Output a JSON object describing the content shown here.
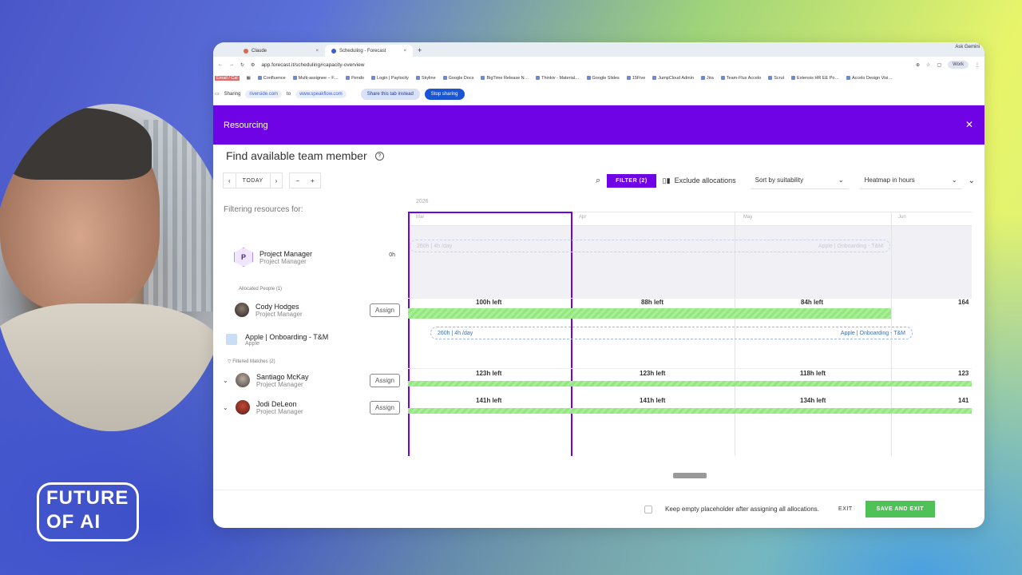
{
  "overlay": {
    "logo_line1": "FUTURE",
    "logo_line2": "OF AI"
  },
  "browser": {
    "tabs": [
      {
        "label": "Claude"
      },
      {
        "label": "Scheduling - Forecast"
      }
    ],
    "ask": "Ask Gemini",
    "url": "app.forecast.it/scheduling#capacity-overview",
    "profile": "Work",
    "bookmarks": [
      "Email / Cal",
      "Confluence",
      "Multi-assignee – F…",
      "Pendo",
      "Login | Paylocity",
      "Skyline",
      "Google Docs",
      "BigTime Release N…",
      "Thinkiv - Material…",
      "Google Slides",
      "15Five",
      "JumpCloud Admin",
      "Jira",
      "Team-Flux Accelo",
      "Scrut",
      "Extensis HR EE Po…",
      "Accelo Design Visi…"
    ],
    "share": {
      "label": "Sharing",
      "from": "riverside.com",
      "to_label": "to",
      "to": "www.speakflow.com",
      "share_this": "Share this tab instead",
      "stop": "Stop sharing"
    }
  },
  "modal": {
    "title": "Resourcing",
    "find_title": "Find available team member",
    "toolbar": {
      "today": "TODAY",
      "filter": "FILTER (2)",
      "exclude": "Exclude allocations",
      "sort": "Sort by suitability",
      "heatmap": "Heatmap in hours"
    },
    "filtering_for": "Filtering resources for:",
    "placeholder": {
      "initial": "P",
      "name": "Project Manager",
      "role": "Project Manager",
      "hours": "0h"
    },
    "allocated_label": "Allocated People (1)",
    "allocated": [
      {
        "name": "Cody Hodges",
        "role": "Project Manager",
        "assign": "Assign"
      }
    ],
    "project": {
      "name": "Apple | Onboarding - T&M",
      "client": "Apple"
    },
    "filtered_label": "Filtered Matches (2)",
    "matches": [
      {
        "name": "Santiago McKay",
        "role": "Project Manager",
        "assign": "Assign"
      },
      {
        "name": "Jodi DeLeon",
        "role": "Project Manager",
        "assign": "Assign"
      }
    ],
    "timeline": {
      "year": "2026",
      "months": [
        "Mar",
        "Apr",
        "May",
        "Jun"
      ],
      "placeholder_pill": {
        "left": "260h | 4h /day",
        "right": "Apple | Onboarding - T&M"
      },
      "project_pill": {
        "left": "260h | 4h /day",
        "right": "Apple | Onboarding - T&M"
      },
      "cody": [
        "100h left",
        "88h left",
        "84h left",
        "164"
      ],
      "santiago": [
        "123h left",
        "123h left",
        "118h left",
        "123"
      ],
      "jodi": [
        "141h left",
        "141h left",
        "134h left",
        "141"
      ]
    },
    "footer": {
      "keep": "Keep empty placeholder after assigning all allocations.",
      "exit": "EXIT",
      "save": "SAVE AND EXIT"
    }
  }
}
